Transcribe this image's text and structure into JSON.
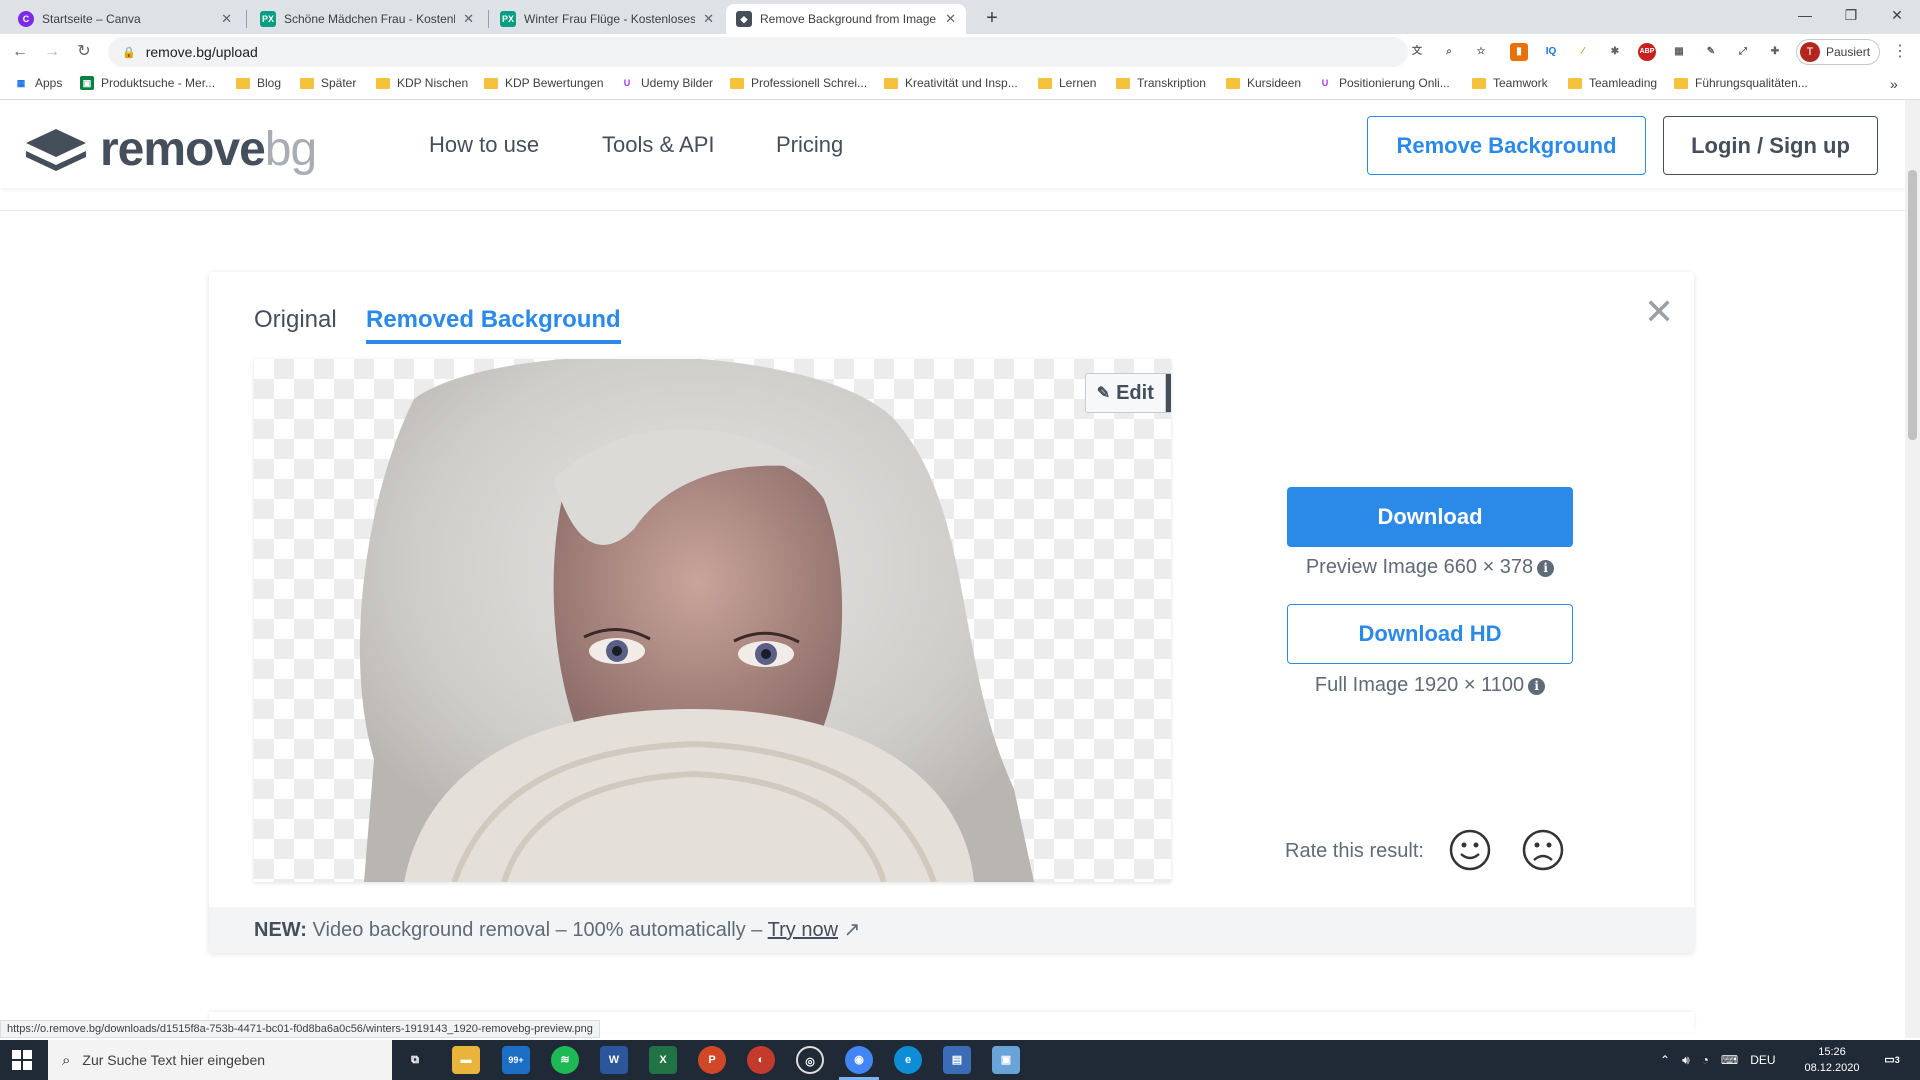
{
  "browser": {
    "tabs": [
      {
        "title": "Startseite – Canva",
        "active": false
      },
      {
        "title": "Schöne Mädchen Frau - Kostenlo",
        "active": false
      },
      {
        "title": "Winter Frau Flüge - Kostenloses F",
        "active": false
      },
      {
        "title": "Remove Background from Image",
        "active": true
      }
    ],
    "url": "remove.bg/upload",
    "profile_label": "Pausiert",
    "profile_initial": "T",
    "bookmarks": [
      "Apps",
      "Produktsuche - Mer...",
      "Blog",
      "Später",
      "KDP Nischen",
      "KDP Bewertungen",
      "Udemy Bilder",
      "Professionell Schrei...",
      "Kreativität und Insp...",
      "Lernen",
      "Transkription",
      "Kursideen",
      "Positionierung Onli...",
      "Teamwork",
      "Teamleading",
      "Führungsqualitäten..."
    ],
    "status_url": "https://o.remove.bg/downloads/d1515f8a-753b-4471-bc01-f0d8ba6a0c56/winters-1919143_1920-removebg-preview.png"
  },
  "site": {
    "logo_main": "remove",
    "logo_suffix": "bg",
    "nav": [
      "How to use",
      "Tools & API",
      "Pricing"
    ],
    "remove_bg_button": "Remove Background",
    "login_button": "Login / Sign up"
  },
  "result": {
    "tab_original": "Original",
    "tab_removed": "Removed Background",
    "edit_label": "Edit",
    "download_label": "Download",
    "preview_info": "Preview Image 660 × 378",
    "download_hd_label": "Download HD",
    "full_info": "Full Image 1920 × 1100",
    "rate_label": "Rate this result:",
    "promo_new": "NEW:",
    "promo_text": "Video background removal – 100% automatically –",
    "promo_link": "Try now"
  },
  "taskbar": {
    "search_placeholder": "Zur Suche Text hier eingeben",
    "mail_badge": "99+",
    "language": "DEU",
    "time": "15:26",
    "date": "08.12.2020",
    "notification_count": "3"
  },
  "colors": {
    "accent": "#2b8ae8",
    "text_dark": "#454f5b",
    "taskbar": "#1f2a36"
  }
}
